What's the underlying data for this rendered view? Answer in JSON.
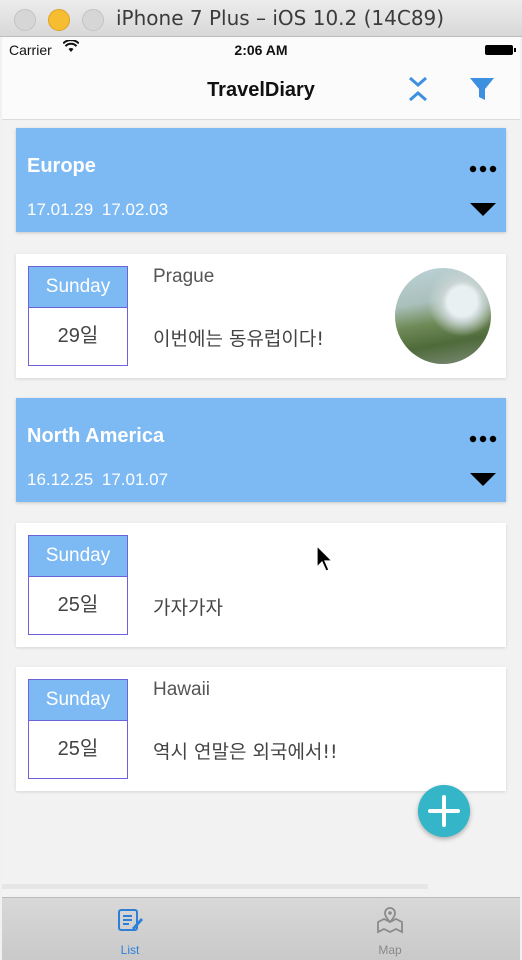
{
  "window": {
    "title": "iPhone 7 Plus – iOS 10.2 (14C89)"
  },
  "status": {
    "carrier": "Carrier",
    "time": "2:06 AM"
  },
  "nav": {
    "title": "TravelDiary"
  },
  "sections": [
    {
      "title": "Europe",
      "dates": "17.01.29 17.02.03"
    },
    {
      "title": "North America",
      "dates": "16.12.25 17.01.07"
    }
  ],
  "cards": [
    {
      "day": "Sunday",
      "date": "29일",
      "place": "Prague",
      "text": "이번에는 동유럽이다!"
    },
    {
      "day": "Sunday",
      "date": "25일",
      "place": "",
      "text": "가자가자"
    },
    {
      "day": "Sunday",
      "date": "25일",
      "place": "Hawaii",
      "text": "역시 연말은 외국에서!!"
    }
  ],
  "tabs": [
    {
      "label": "List"
    },
    {
      "label": "Map"
    }
  ],
  "colors": {
    "section_blue": "#7dbaf3",
    "accent": "#2f7fd9",
    "fab": "#35b5c8"
  }
}
